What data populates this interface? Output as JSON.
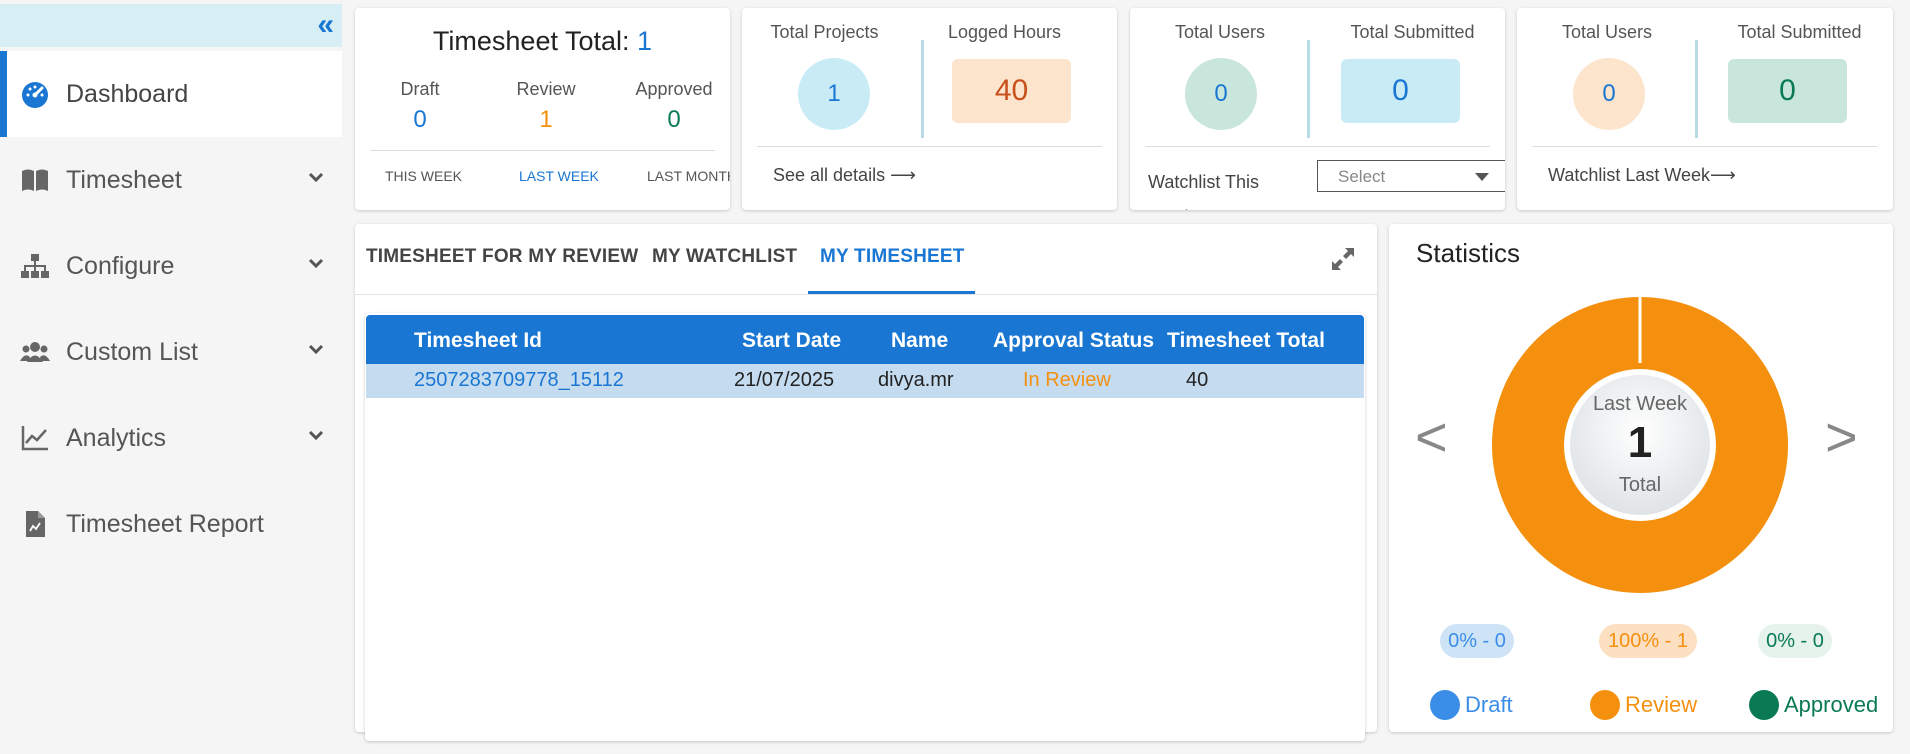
{
  "sidebar": {
    "collapse_icon": "double-chevron-left-icon",
    "items": [
      {
        "label": "Dashboard",
        "icon": "speedometer-icon"
      },
      {
        "label": "Timesheet",
        "icon": "book-icon"
      },
      {
        "label": "Configure",
        "icon": "sitemap-icon"
      },
      {
        "label": "Custom List",
        "icon": "users-icon"
      },
      {
        "label": "Analytics",
        "icon": "chart-line-icon"
      },
      {
        "label": "Timesheet Report",
        "icon": "report-file-icon"
      }
    ]
  },
  "timesheet_card": {
    "title": "Timesheet Total:",
    "total": "1",
    "draft_label": "Draft",
    "draft_value": "0",
    "review_label": "Review",
    "review_value": "1",
    "approved_label": "Approved",
    "approved_value": "0",
    "periods": [
      "THIS WEEK",
      "LAST WEEK",
      "LAST MONTH"
    ]
  },
  "projects_card": {
    "projects_label": "Total Projects",
    "projects_value": "1",
    "hours_label": "Logged Hours",
    "hours_value": "40",
    "link": "See all details ⟶"
  },
  "watch_this_card": {
    "users_label": "Total Users",
    "users_value": "0",
    "submitted_label": "Total Submitted",
    "submitted_value": "0",
    "link": "Watchlist This Week ⟶",
    "select_placeholder": "Select"
  },
  "watch_last_card": {
    "users_label": "Total Users",
    "users_value": "0",
    "submitted_label": "Total Submitted",
    "submitted_value": "0",
    "link": "Watchlist Last Week⟶"
  },
  "tabs": [
    "TIMESHEET FOR MY REVIEW",
    "MY WATCHLIST",
    "MY TIMESHEET"
  ],
  "table": {
    "headers": [
      "Timesheet Id",
      "Start Date",
      "Name",
      "Approval Status",
      "Timesheet Total"
    ],
    "rows": [
      {
        "id": "2507283709778_15112",
        "start": "21/07/2025",
        "name": "divya.mr",
        "status": "In Review",
        "total": "40"
      }
    ]
  },
  "statistics": {
    "title": "Statistics",
    "center_top": "Last Week",
    "center_value": "1",
    "center_bottom": "Total",
    "prev": "<",
    "next": ">",
    "pills": [
      "0% - 0",
      "100% - 1",
      "0% - 0"
    ],
    "legend": [
      "Draft",
      "Review",
      "Approved"
    ]
  },
  "colors": {
    "accent": "#1976d2",
    "review": "#f5900f",
    "approved": "#0a7a54",
    "draft": "#3b8ee8"
  },
  "chart_data": {
    "type": "pie",
    "categories": [
      "Draft",
      "Review",
      "Approved"
    ],
    "values": [
      0,
      1,
      0
    ],
    "title": "Statistics"
  }
}
